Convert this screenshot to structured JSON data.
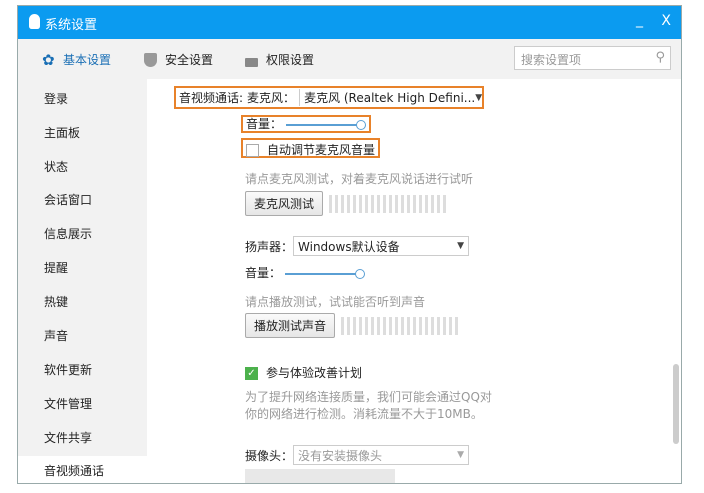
{
  "window": {
    "title": "系统设置",
    "minimize": "_",
    "close": "X"
  },
  "toolbar": {
    "tabs": [
      {
        "label": "基本设置",
        "active": true
      },
      {
        "label": "安全设置"
      },
      {
        "label": "权限设置"
      }
    ],
    "search_placeholder": "搜索设置项"
  },
  "sidebar": {
    "items": [
      "登录",
      "主面板",
      "状态",
      "会话窗口",
      "信息展示",
      "提醒",
      "热键",
      "声音",
      "软件更新",
      "文件管理",
      "文件共享",
      "音视频通话"
    ],
    "selected": "音视频通话"
  },
  "av": {
    "section_label": "音视频通话:",
    "mic_label": "麦克风：",
    "mic_value": "麦克风 (Realtek High Defini...",
    "volume_label": "音量：",
    "mic_volume": 0.9,
    "auto_adjust_label": "自动调节麦克风音量",
    "auto_adjust_checked": false,
    "mic_hint": "请点麦克风测试，对着麦克风说话进行试听",
    "mic_test_button": "麦克风测试",
    "speaker_label": "扬声器：",
    "speaker_value": "Windows默认设备",
    "speaker_volume": 0.9,
    "speaker_hint": "请点播放测试，试试能否听到声音",
    "play_test_button": "播放测试声音",
    "improve_label": "参与体验改善计划",
    "improve_checked": true,
    "improve_desc1": "为了提升网络连接质量，我们可能会通过QQ对",
    "improve_desc2": "你的网络进行检测。消耗流量不大于10MB。",
    "camera_label": "摄像头：",
    "camera_value": "没有安装摄像头"
  },
  "colors": {
    "titlebar": "#0b9bf0",
    "highlight": "#e8822a",
    "active_tab": "#1a6fb5"
  }
}
